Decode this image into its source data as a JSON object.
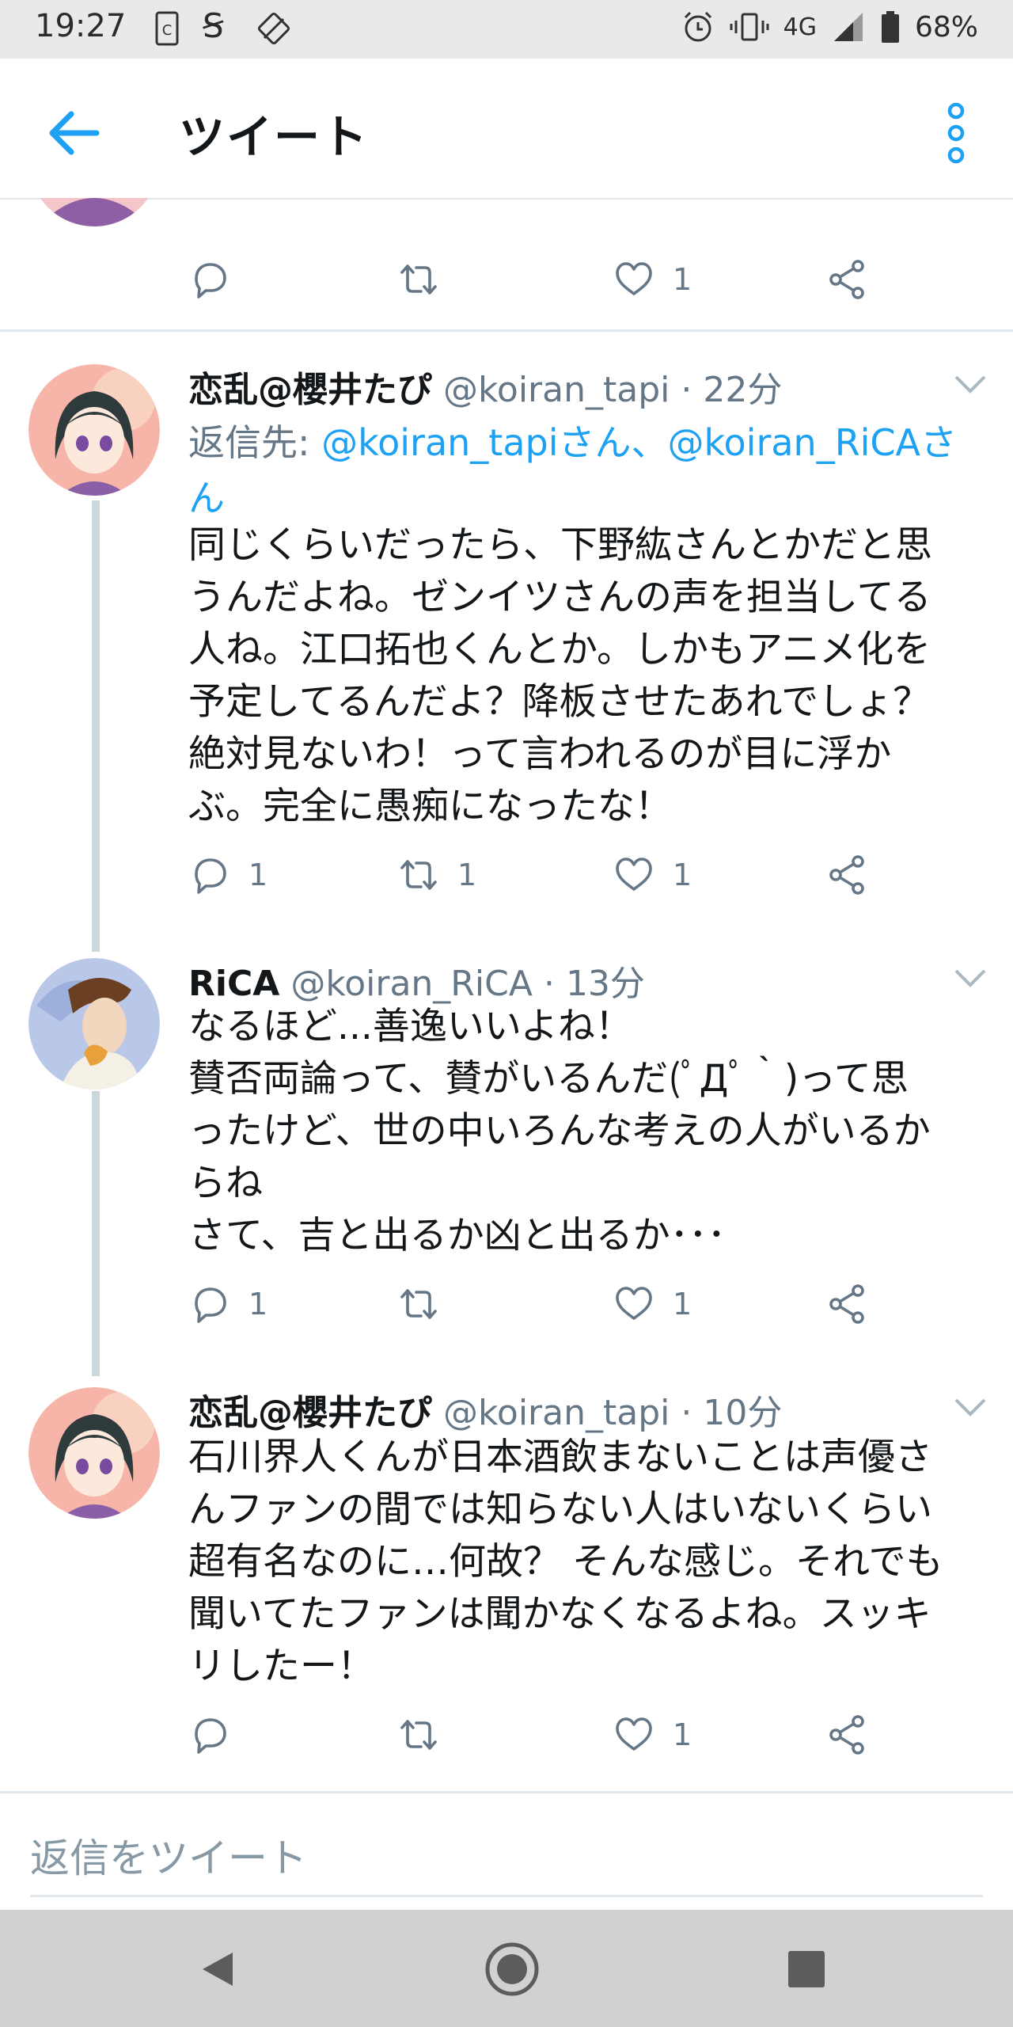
{
  "status_bar": {
    "time": "19:27",
    "network": "4G",
    "battery": "68%"
  },
  "header": {
    "title": "ツイート"
  },
  "top_tweet": {
    "like_count": "1"
  },
  "tweets": [
    {
      "name": "恋乱@櫻井たぴ",
      "handle": "@koiran_tapi",
      "time": "22分",
      "reply_prefix": "返信先: ",
      "reply_link1": "@koiran_tapiさん",
      "reply_sep": "、",
      "reply_link2": "@koiran_RiCAさん",
      "text": "同じくらいだったら、下野紘さんとかだと思\nうんだよね。ゼンイツさんの声を担当してる\n人ね。江口拓也くんとか。しかもアニメ化を\n予定してるんだよ？降板させたあれでしょ？\n絶対見ないわ！って言われるのが目に浮か\nぶ。完全に愚痴になったな！",
      "reply_count": "1",
      "retweet_count": "1",
      "like_count": "1"
    },
    {
      "name": "RiCA",
      "handle": "@koiran_RiCA",
      "time": "13分",
      "text": "なるほど...善逸いいよね！\n賛否両論って、賛がいるんだ(ﾟДﾟ｀)って思\nったけど、世の中いろんな考えの人がいるか\nらね\nさて、吉と出るか凶と出るか･･･",
      "reply_count": "1",
      "retweet_count": "",
      "like_count": "1"
    },
    {
      "name": "恋乱@櫻井たぴ",
      "handle": "@koiran_tapi",
      "time": "10分",
      "text": "石川界人くんが日本酒飲まないことは声優さ\nんファンの間では知らない人はいないくらい\n超有名なのに…何故？ そんな感じ。それでも\n聞いてたファンは聞かなくなるよね。スッキ\nリしたー！",
      "reply_count": "",
      "retweet_count": "",
      "like_count": "1"
    }
  ],
  "compose": {
    "placeholder": "返信をツイート"
  },
  "colors": {
    "accent": "#1da1f2",
    "secondary_text": "#657786",
    "divider": "#e1e8ed"
  }
}
